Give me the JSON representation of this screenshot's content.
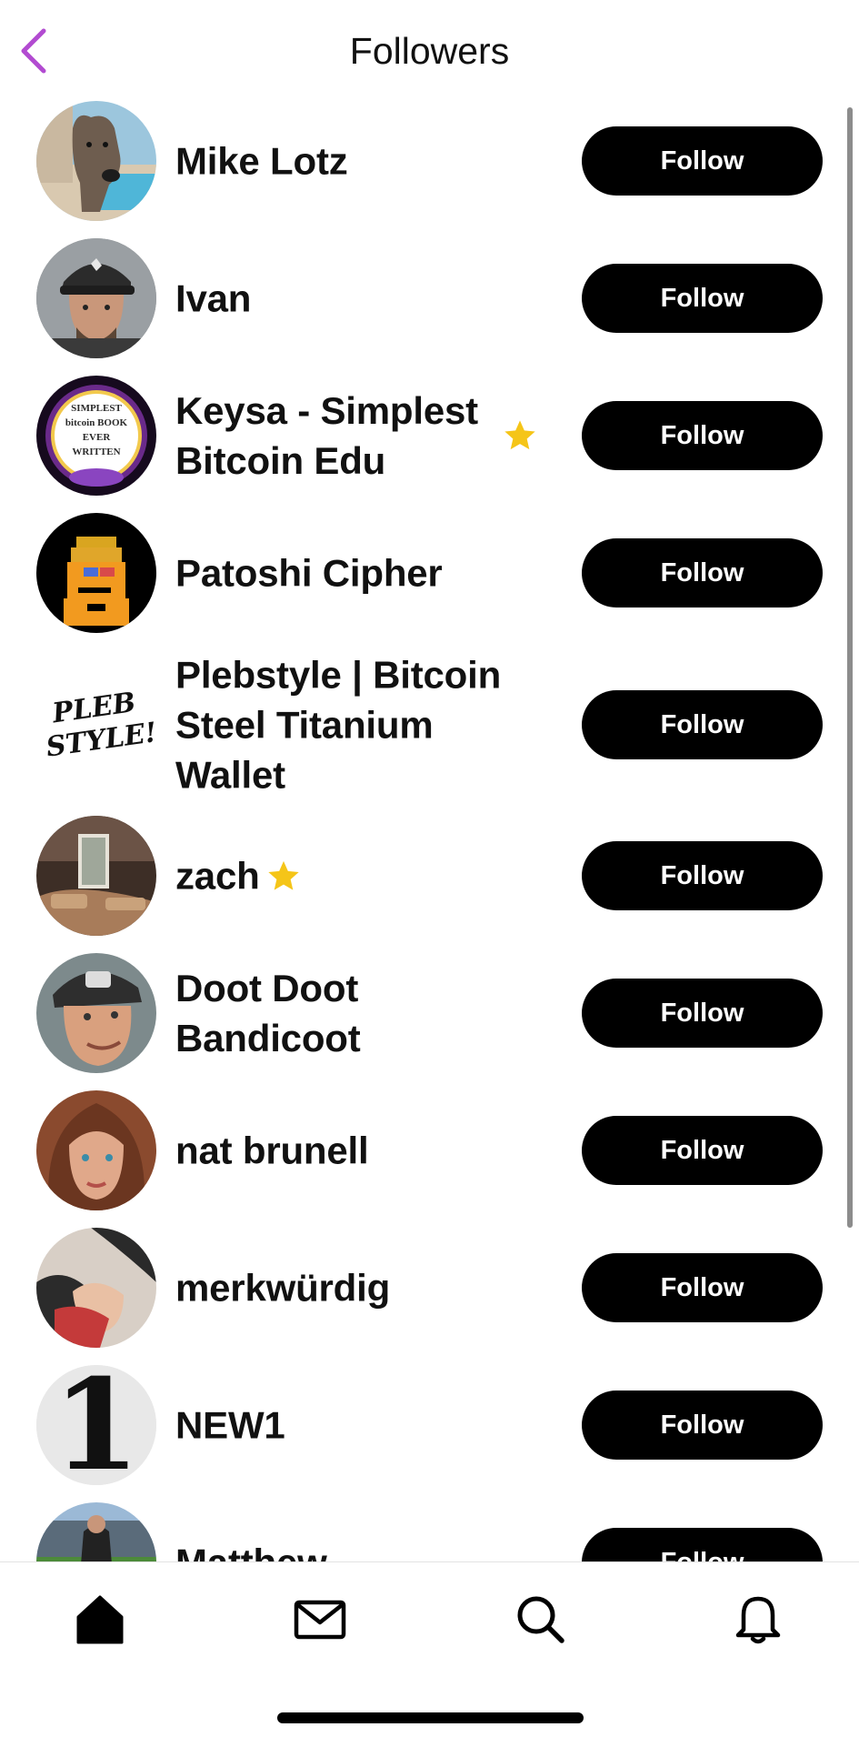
{
  "header": {
    "title": "Followers",
    "back_icon": "chevron-left-icon",
    "accent": "#b24bd1"
  },
  "followers": [
    {
      "name": "Mike Lotz",
      "follow_label": "Follow",
      "avatar": "dog-photo"
    },
    {
      "name": "Ivan",
      "follow_label": "Follow",
      "avatar": "man-in-cap-photo"
    },
    {
      "name": "Keysa - Simplest Bitcoin Edu",
      "follow_label": "Follow",
      "avatar": "book-logo",
      "avatar_text": "SIMPLEST bitcoin BOOK EVER WRITTEN",
      "starred": true
    },
    {
      "name": "Patoshi Cipher",
      "follow_label": "Follow",
      "avatar": "pixel-character"
    },
    {
      "name": "Plebstyle | Bitcoin Steel Titanium Wallet",
      "follow_label": "Follow",
      "avatar": "plebstyle-logo",
      "avatar_text": "PLEB STYLE!"
    },
    {
      "name": "zach",
      "follow_label": "Follow",
      "avatar": "restaurant-photo",
      "starred": true
    },
    {
      "name": "Doot Doot Bandicoot",
      "follow_label": "Follow",
      "avatar": "man-smiling-photo"
    },
    {
      "name": "nat brunell",
      "follow_label": "Follow",
      "avatar": "woman-portrait"
    },
    {
      "name": "merkwürdig",
      "follow_label": "Follow",
      "avatar": "anime-art"
    },
    {
      "name": "NEW1",
      "follow_label": "Follow",
      "avatar": "numeral-one-logo",
      "avatar_text": "1"
    },
    {
      "name": "Matthew",
      "follow_label": "Follow",
      "avatar": "stadium-photo"
    }
  ],
  "tabbar": {
    "items": [
      {
        "name": "home",
        "icon": "home-icon",
        "active": true
      },
      {
        "name": "messages",
        "icon": "mail-icon"
      },
      {
        "name": "search",
        "icon": "search-icon"
      },
      {
        "name": "notifications",
        "icon": "bell-icon"
      }
    ]
  },
  "colors": {
    "button_bg": "#000000",
    "button_text": "#ffffff",
    "star": "#f5c518"
  }
}
